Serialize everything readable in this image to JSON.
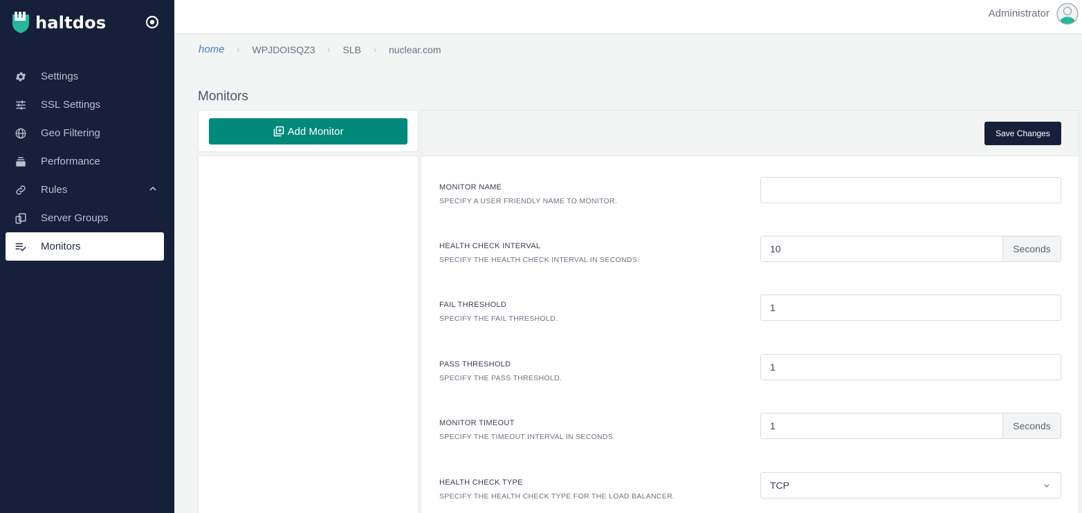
{
  "brand": {
    "name": "haltdos"
  },
  "sidebar": {
    "items": [
      {
        "label": "Settings",
        "icon": "gear-icon"
      },
      {
        "label": "SSL Settings",
        "icon": "sliders-icon"
      },
      {
        "label": "Geo Filtering",
        "icon": "globe-icon"
      },
      {
        "label": "Performance",
        "icon": "layers-icon"
      },
      {
        "label": "Rules",
        "icon": "link-icon"
      },
      {
        "label": "Server Groups",
        "icon": "copy-icon"
      },
      {
        "label": "Monitors",
        "icon": "checklist-icon"
      }
    ]
  },
  "topbar": {
    "user": "Administrator"
  },
  "breadcrumb": [
    "home",
    "WPJDOISQZ3",
    "SLB",
    "nuclear.com"
  ],
  "page": {
    "title": "Monitors"
  },
  "left": {
    "add_label": "Add Monitor"
  },
  "right": {
    "save_label": "Save Changes"
  },
  "fields": [
    {
      "label": "MONITOR NAME",
      "help": "SPECIFY A USER FRIENDLY NAME TO MONITOR.",
      "value": ""
    },
    {
      "label": "HEALTH CHECK INTERVAL",
      "help": "SPECIFY THE HEALTH CHECK INTERVAL IN SECONDS.",
      "value": "10",
      "addon": "Seconds"
    },
    {
      "label": "FAIL THRESHOLD",
      "help": "SPECIFY THE FAIL THRESHOLD.",
      "value": "1"
    },
    {
      "label": "PASS THRESHOLD",
      "help": "SPECIFY THE PASS THRESHOLD.",
      "value": "1"
    },
    {
      "label": "MONITOR TIMEOUT",
      "help": "SPECIFY THE TIMEOUT INTERVAL IN SECONDS.",
      "value": "1",
      "addon": "Seconds"
    },
    {
      "label": "HEALTH CHECK TYPE",
      "help": "SPECIFY THE HEALTH CHECK TYPE FOR THE LOAD BALANCER.",
      "value": "TCP"
    }
  ],
  "colors": {
    "sidebar": "#17203a",
    "accent": "#00897b",
    "save": "#17203a"
  }
}
